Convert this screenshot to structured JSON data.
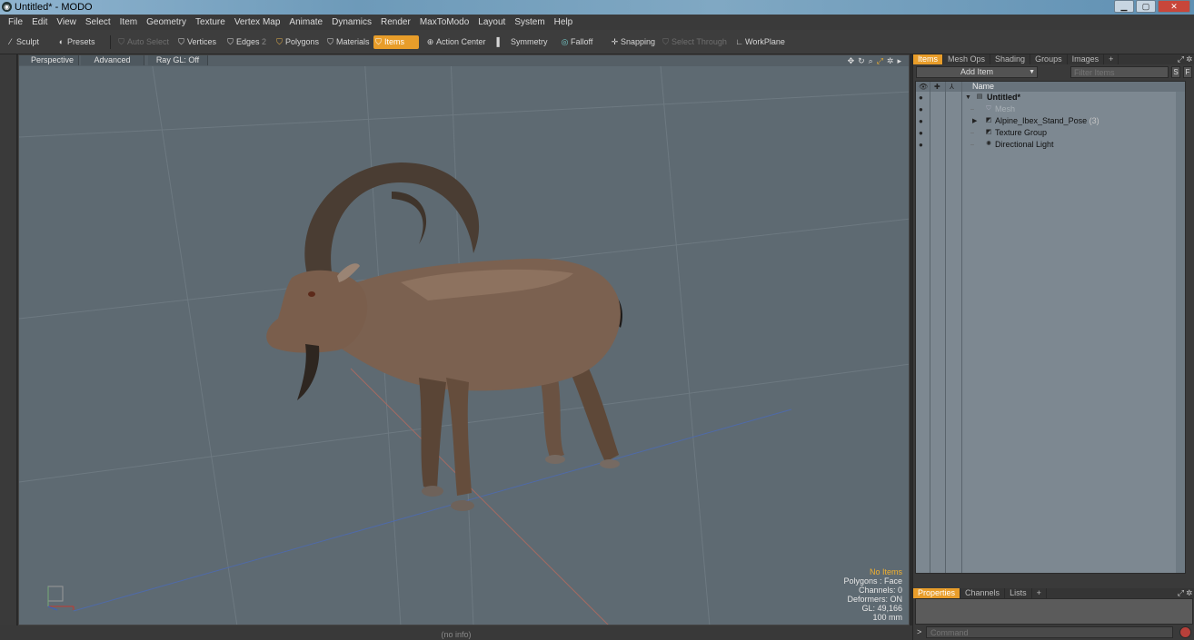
{
  "window": {
    "title": "Untitled* - MODO",
    "app_icon": "modo-logo-icon"
  },
  "menubar": [
    "File",
    "Edit",
    "View",
    "Select",
    "Item",
    "Geometry",
    "Texture",
    "Vertex Map",
    "Animate",
    "Dynamics",
    "Render",
    "MaxToModo",
    "Layout",
    "System",
    "Help"
  ],
  "toolbar": {
    "sculpt": "Sculpt",
    "presets": "Presets",
    "auto_select": "Auto Select",
    "vertices": "Vertices",
    "edges": "Edges",
    "edges_count": "2",
    "polygons": "Polygons",
    "materials": "Materials",
    "items": "Items",
    "action_center": "Action Center",
    "symmetry": "Symmetry",
    "falloff": "Falloff",
    "snapping": "Snapping",
    "select_through": "Select Through",
    "workplane": "WorkPlane"
  },
  "viewport": {
    "tabs": {
      "perspective": "Perspective",
      "advanced": "Advanced",
      "raygl": "Ray GL: Off"
    },
    "info": {
      "no_items": "No Items",
      "polygons": "Polygons : Face",
      "channels": "Channels: 0",
      "deformers": "Deformers: ON",
      "gl": "GL: 49,166",
      "scale": "100 mm"
    },
    "accent_color": "#e89d2a",
    "background_color": "#5e6a72"
  },
  "statusbar": {
    "info": "(no info)"
  },
  "right_panel": {
    "top_tabs": [
      "Items",
      "Mesh Ops",
      "Shading",
      "Groups",
      "Images"
    ],
    "add_tab": "+",
    "add_item": "Add Item",
    "filter_placeholder": "Filter Items",
    "s_button": "S",
    "f_button": "F",
    "tree_header": "Name",
    "tree": [
      {
        "label": "Untitled*",
        "count": ""
      },
      {
        "label": "Mesh",
        "count": ""
      },
      {
        "label": "Alpine_Ibex_Stand_Pose",
        "count": "(3)"
      },
      {
        "label": "Texture Group",
        "count": ""
      },
      {
        "label": "Directional Light",
        "count": ""
      }
    ],
    "bottom_tabs": [
      "Properties",
      "Channels",
      "Lists"
    ],
    "command_placeholder": "Command",
    "command_prompt": ">"
  }
}
